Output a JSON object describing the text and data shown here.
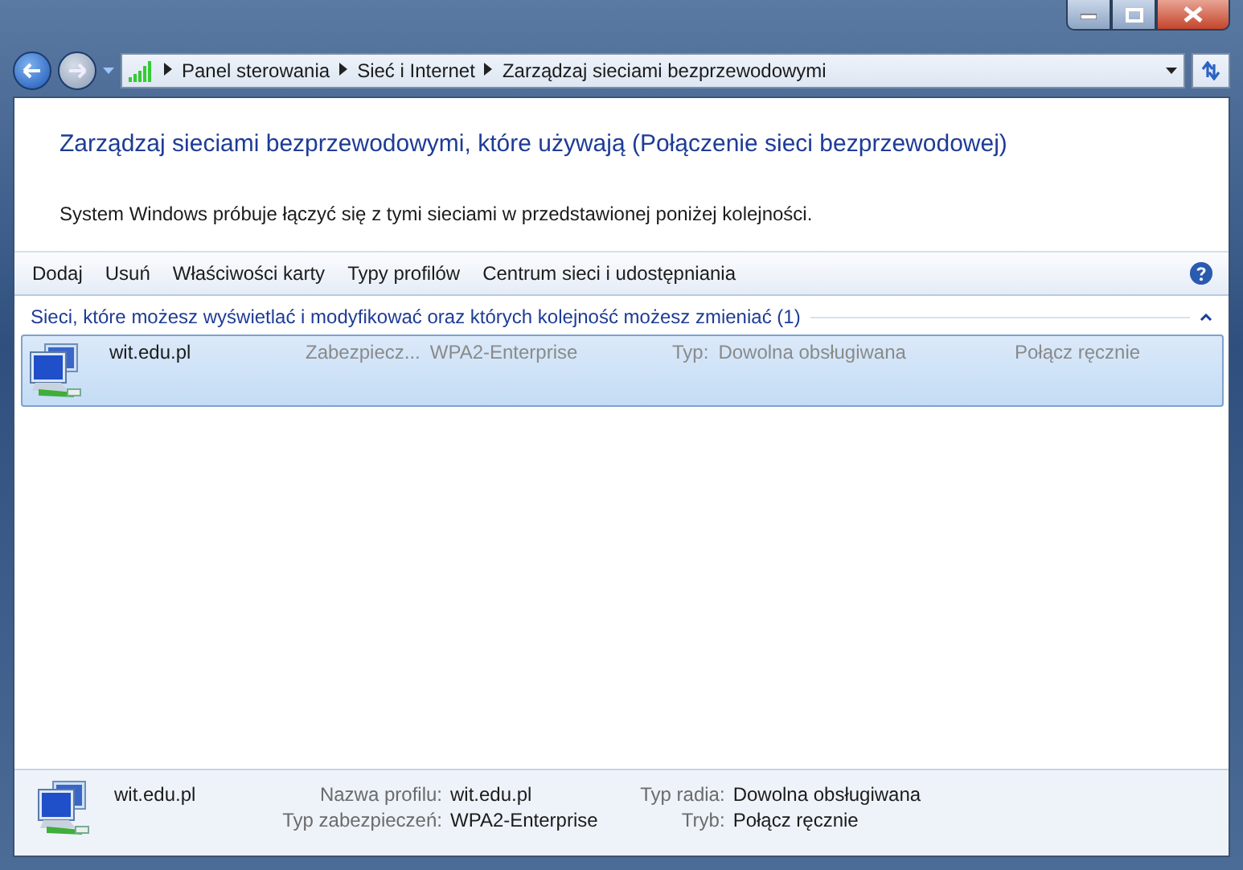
{
  "address_bar": {
    "breadcrumbs": [
      "Panel sterowania",
      "Sieć i Internet",
      "Zarządzaj sieciami bezprzewodowymi"
    ]
  },
  "heading": "Zarządzaj sieciami bezprzewodowymi, które używają (Połączenie sieci bezprzewodowej)",
  "description": "System Windows próbuje łączyć się z tymi sieciami w przedstawionej poniżej kolejności.",
  "toolbar": [
    "Dodaj",
    "Usuń",
    "Właściwości karty",
    "Typy profilów",
    "Centrum sieci i udostępniania"
  ],
  "group": {
    "title": "Sieci, które możesz wyświetlać i modyfikować oraz których kolejność możesz zmieniać (1)",
    "expanded": true,
    "networks": [
      {
        "name": "wit.edu.pl",
        "security_label": "Zabezpiecz...",
        "security": "WPA2-Enterprise",
        "type_label": "Typ:",
        "type": "Dowolna obsługiwana",
        "mode": "Połącz ręcznie",
        "selected": true
      }
    ]
  },
  "details": {
    "name": "wit.edu.pl",
    "fields": [
      {
        "label": "Nazwa profilu:",
        "value": "wit.edu.pl"
      },
      {
        "label": "Typ radia:",
        "value": "Dowolna obsługiwana"
      },
      {
        "label": "Typ zabezpieczeń:",
        "value": "WPA2-Enterprise"
      },
      {
        "label": "Tryb:",
        "value": "Połącz ręcznie"
      }
    ]
  }
}
